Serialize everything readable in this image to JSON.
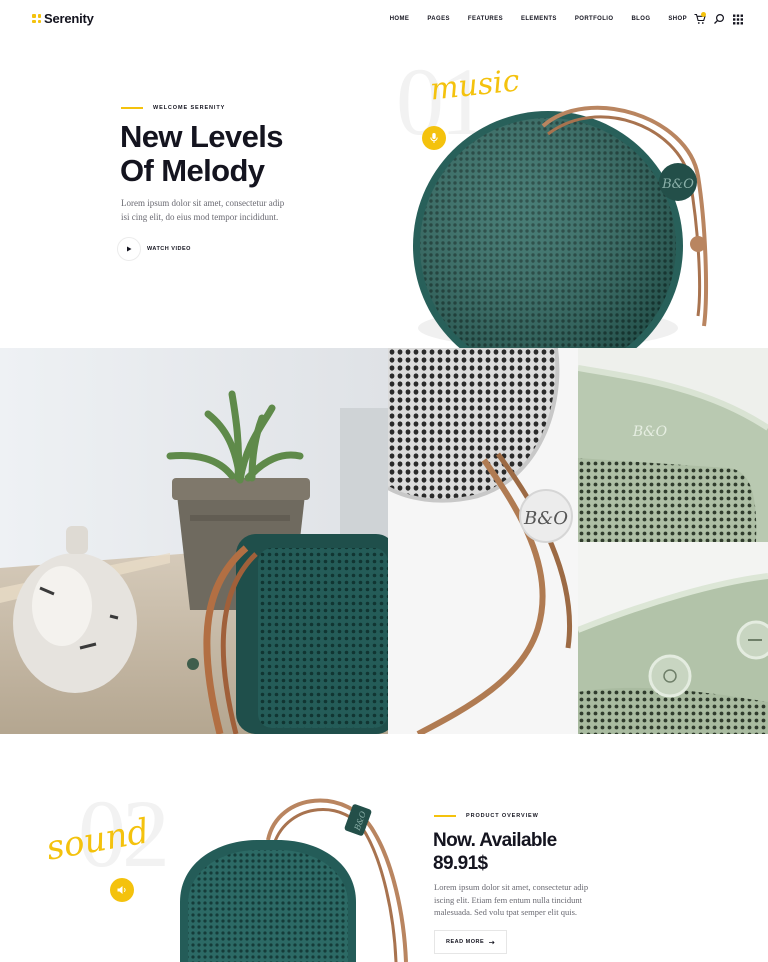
{
  "brand": {
    "name": "Serenity"
  },
  "nav": {
    "items": [
      "HOME",
      "PAGES",
      "FEATURES",
      "ELEMENTS",
      "PORTFOLIO",
      "BLOG",
      "SHOP"
    ]
  },
  "header_icons": {
    "cart": "cart-icon",
    "cart_badge_color": "#f4c20d",
    "search": "search-icon",
    "menu": "grid-menu-icon"
  },
  "hero": {
    "eyebrow": "WELCOME SERENITY",
    "title_line1": "New Levels",
    "title_line2": "Of Melody",
    "body_line1": "Lorem ipsum dolor sit amet, consectetur adip",
    "body_line2": "isi cing elit, do eius mod tempor  incididunt.",
    "watch_label": "WATCH VIDEO",
    "number": "01",
    "script": "music",
    "badge_icon": "microphone-icon"
  },
  "product": {
    "eyebrow": "PRODUCT OVERVIEW",
    "title_line1": "Now. Available",
    "title_line2": "89.91$",
    "body_line1": "Lorem ipsum dolor sit amet, consectetur adip",
    "body_line2": "iscing elit. Etiam fem entum nulla tincidunt",
    "body_line3": "malesuada. Sed volu tpat semper elit quis.",
    "cta_label": "READ MORE",
    "number": "02",
    "script": "sound",
    "badge_icon": "speaker-icon"
  },
  "speaker_logo": "B&O",
  "colors": {
    "accent": "#f4c20d",
    "ink": "#14141f",
    "speaker_teal": "#2f6b63",
    "leather": "#b98560",
    "sage": "#b9c9b1"
  }
}
